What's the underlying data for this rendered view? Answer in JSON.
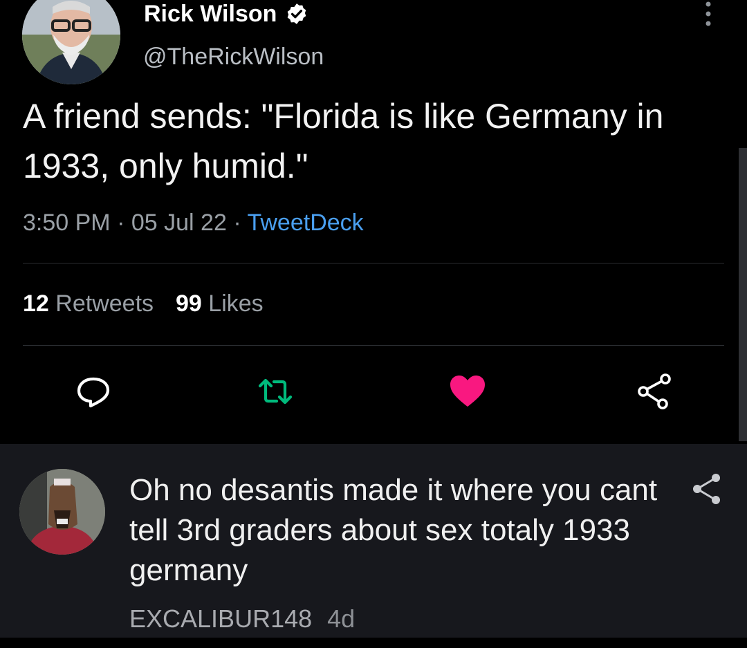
{
  "tweet": {
    "display_name": "Rick Wilson",
    "handle": "@TheRickWilson",
    "text": "A friend sends: \"Florida is like Germany in 1933, only humid.\"",
    "time": "3:50 PM",
    "date": "05 Jul 22",
    "source": "TweetDeck",
    "separator": "·",
    "retweet_count": "12",
    "retweet_label": "Retweets",
    "like_count": "99",
    "like_label": "Likes",
    "actions": [
      "reply-icon",
      "retweet-icon",
      "like-icon",
      "share-icon"
    ],
    "colors": {
      "link": "#4a9ff0",
      "retweet": "#00ba7c",
      "like": "#f91880",
      "verified": "#ffffff"
    }
  },
  "comment": {
    "text": "Oh no desantis made it where you cant tell 3rd graders about sex totaly 1933 germany",
    "author": "EXCALIBUR148",
    "age": "4d",
    "icons": [
      "share-icon"
    ]
  }
}
